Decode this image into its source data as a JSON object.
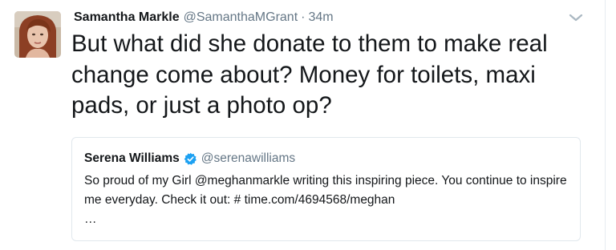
{
  "tweet": {
    "author_name": "Samantha Markle",
    "handle": "@SamanthaMGrant",
    "separator": "·",
    "time": "34m",
    "text": "But what did she donate to them to make real change come about? Money for toilets, maxi pads, or just a photo op?"
  },
  "quoted_tweet": {
    "author_name": "Serena Williams",
    "handle": "@serenawilliams",
    "verified": true,
    "text": "So proud of my Girl @meghanmarkle writing this inspiring piece. You continue to inspire me everyday. Check it out: # time.com/4694568/meghan",
    "ellipsis": "…"
  },
  "icons": {
    "caret": "chevron-down-icon",
    "verified": "verified-badge-icon",
    "avatar": "profile-photo"
  },
  "colors": {
    "text_primary": "#14171a",
    "text_secondary": "#657786",
    "verified_blue": "#1da1f2",
    "border": "#e1e8ed",
    "caret": "#aab8c2"
  }
}
